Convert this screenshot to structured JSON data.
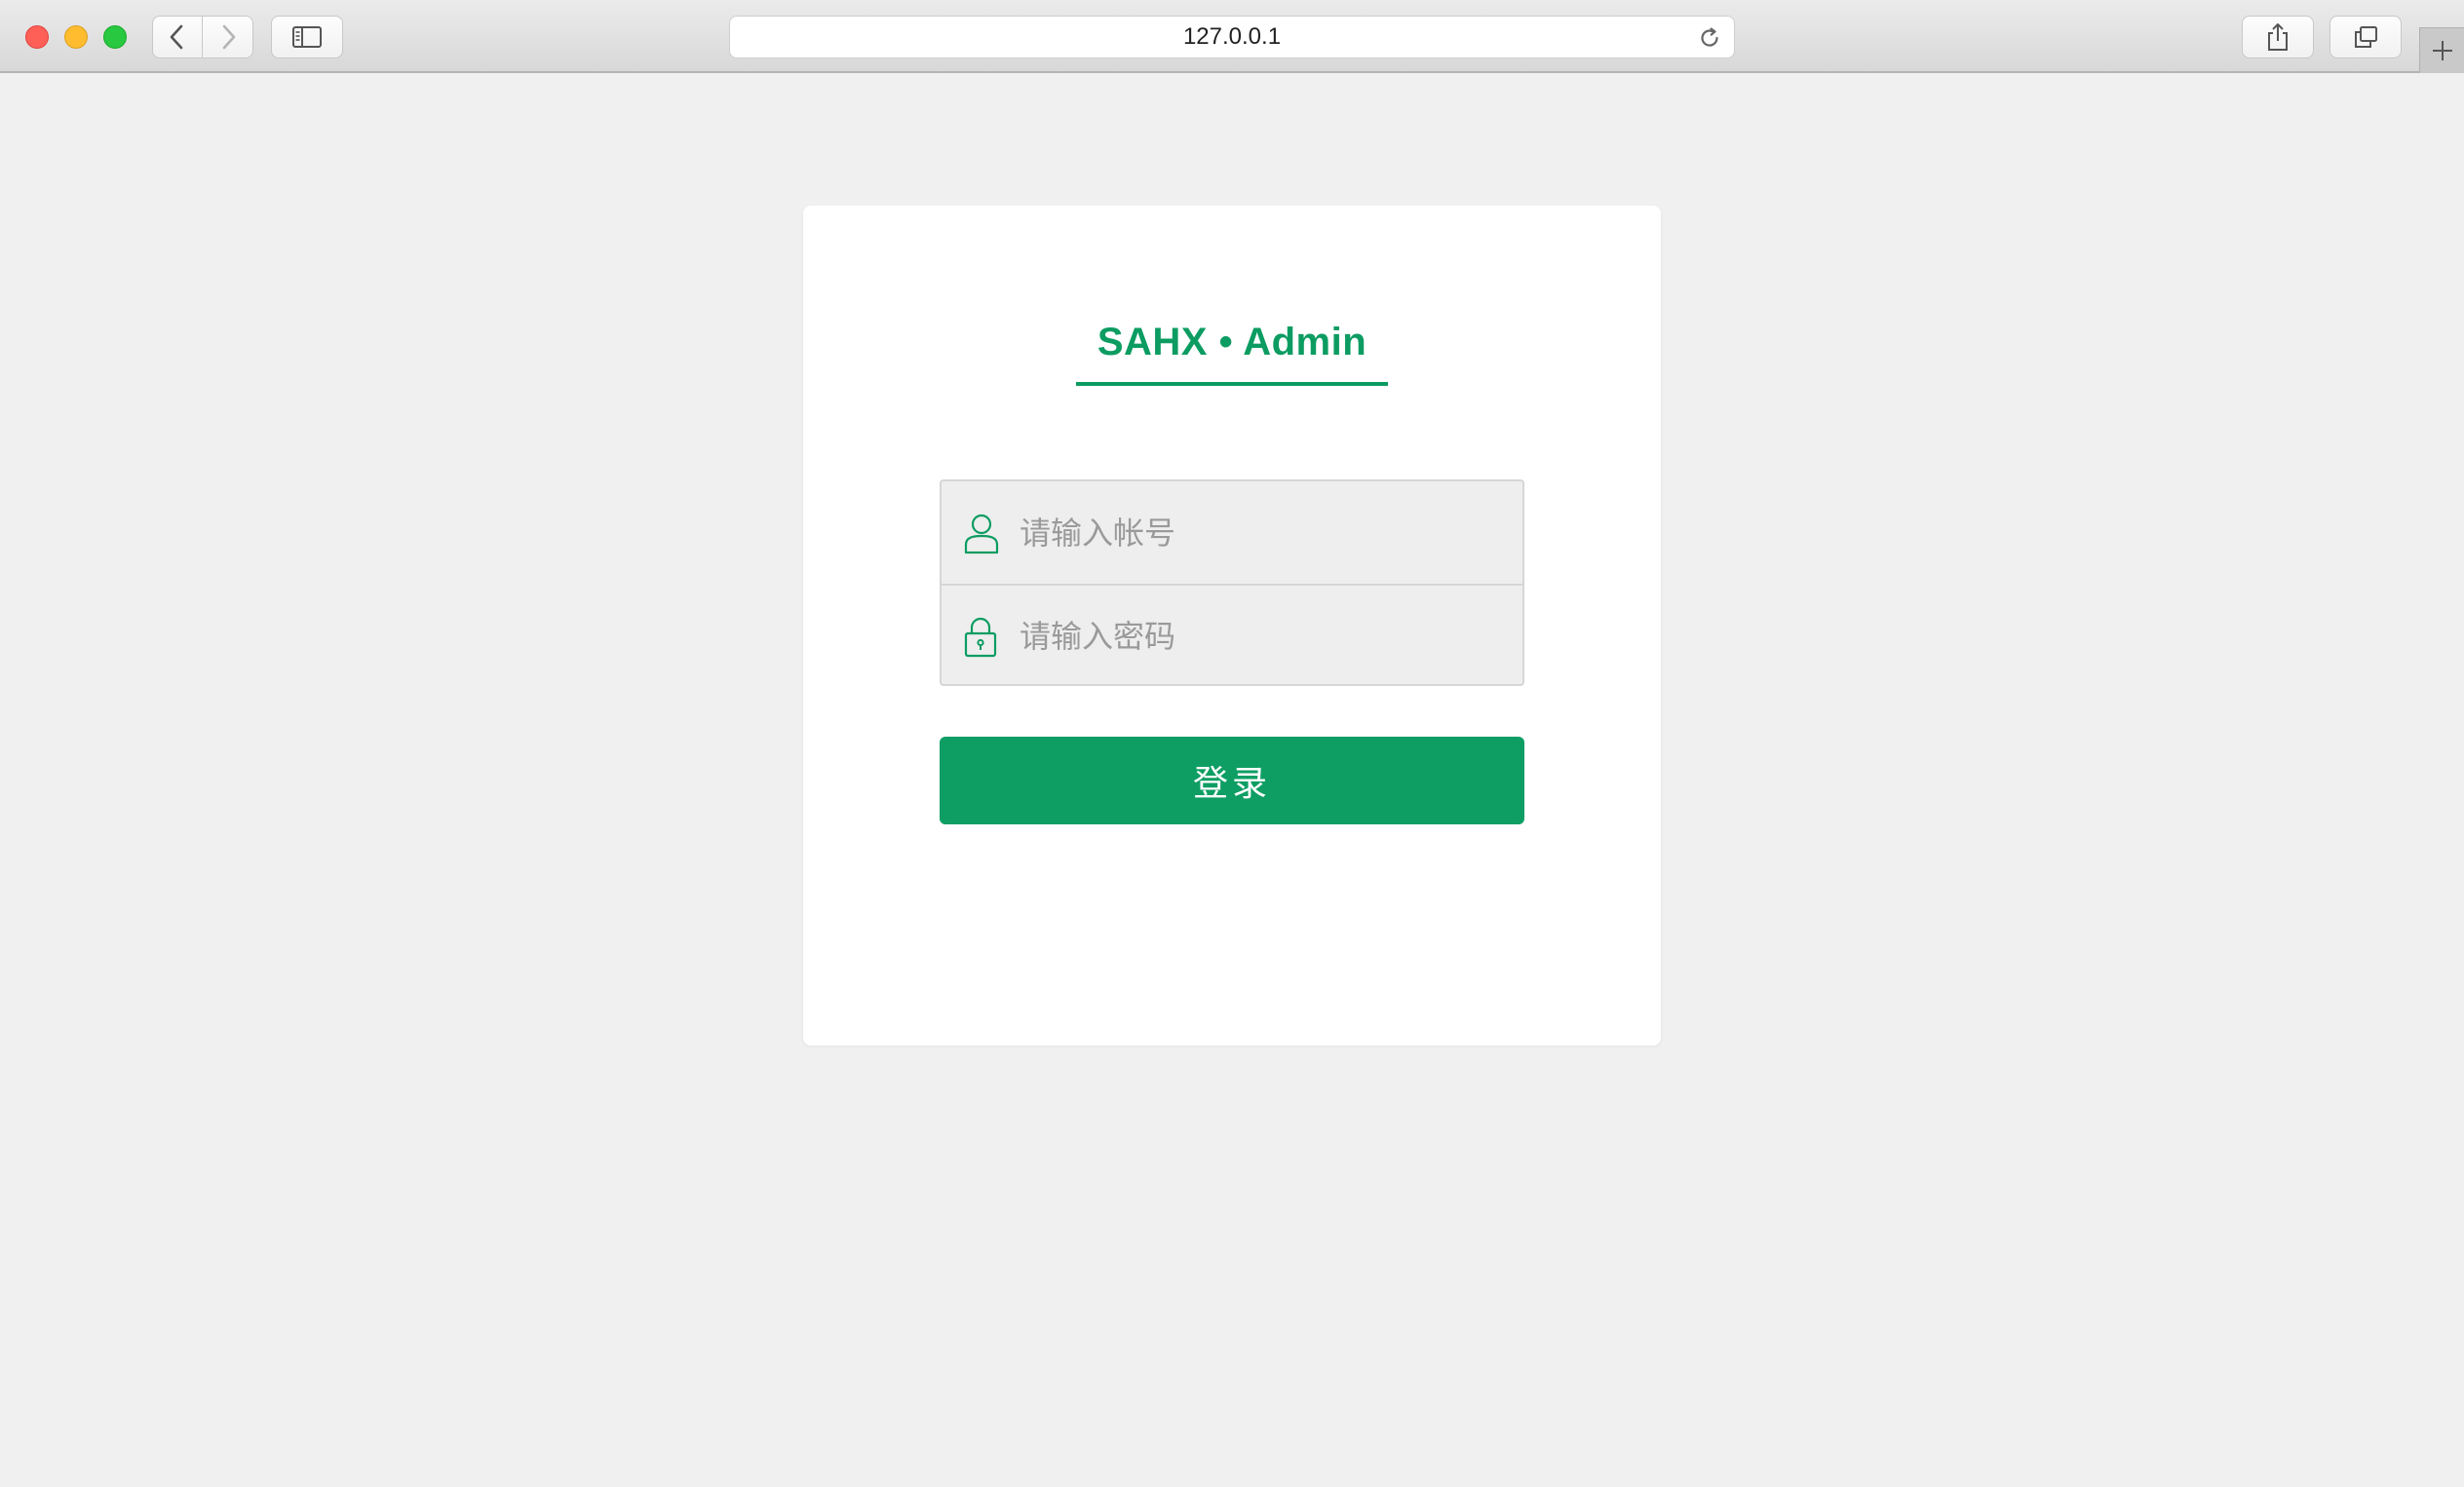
{
  "browser": {
    "url": "127.0.0.1",
    "icons": {
      "back": "chevron-left-icon",
      "forward": "chevron-right-icon",
      "sidebar": "sidebar-icon",
      "reload": "reload-icon",
      "share": "share-icon",
      "tabs": "tabs-icon",
      "new_tab": "plus-icon"
    }
  },
  "login": {
    "brand": "SAHX • Admin",
    "username_placeholder": "请输入帐号",
    "password_placeholder": "请输入密码",
    "submit_label": "登录",
    "icons": {
      "username": "user-icon",
      "password": "lock-icon"
    }
  },
  "colors": {
    "accent": "#0c9c62",
    "page_background": "#f0f0f0",
    "card_background": "#ffffff"
  }
}
